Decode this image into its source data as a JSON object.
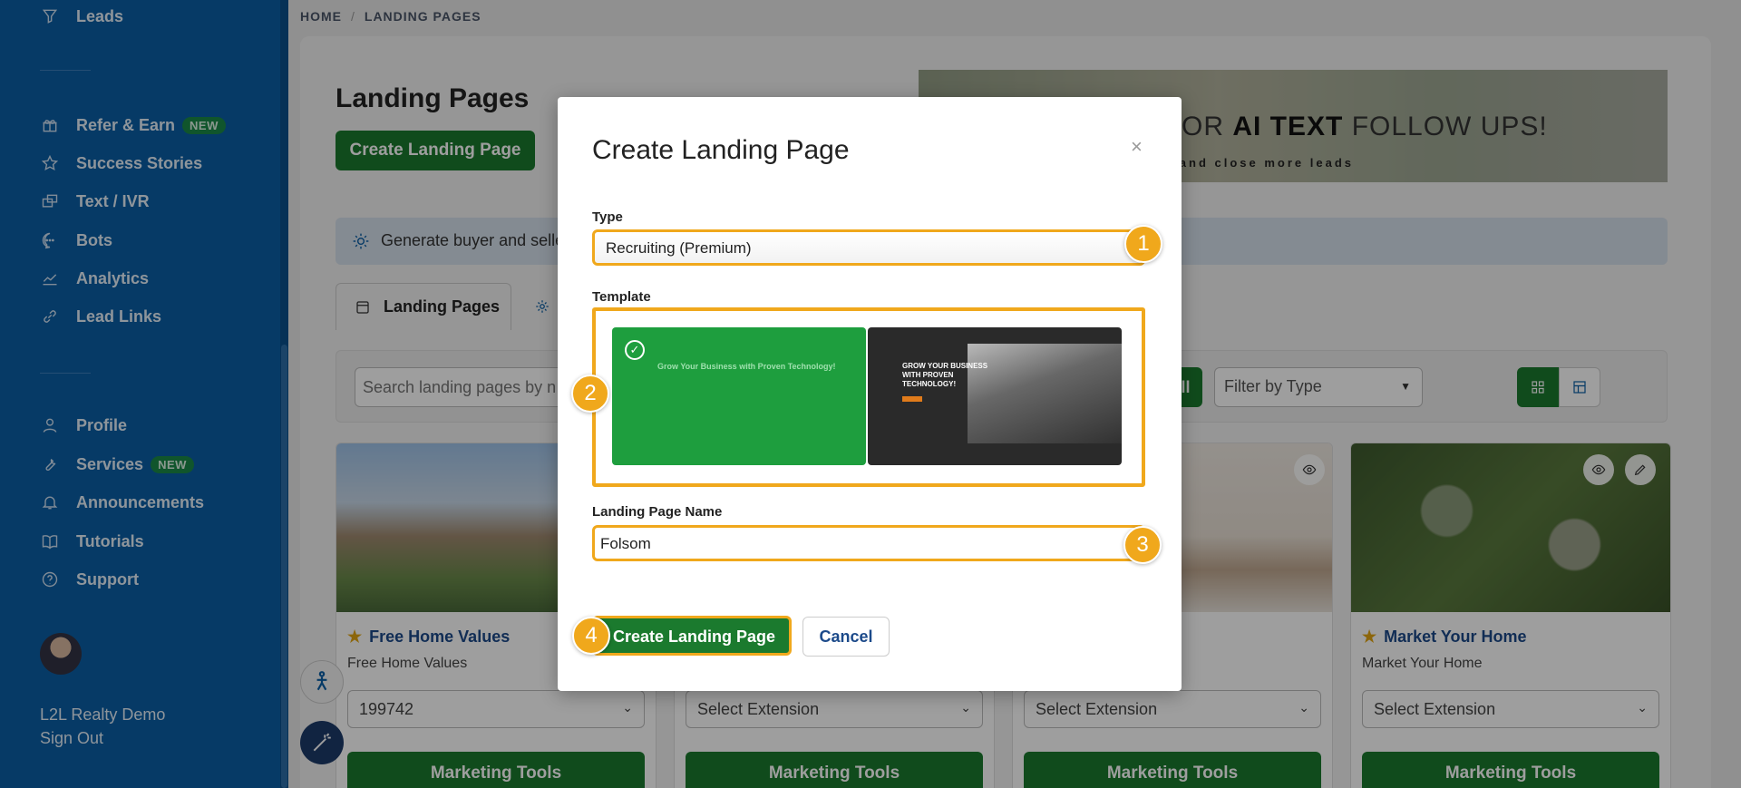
{
  "sidebar": {
    "items_top": [
      {
        "label": "Leads",
        "icon": "filter-icon"
      }
    ],
    "items_mid": [
      {
        "label": "Refer & Earn",
        "icon": "gift-icon",
        "badge": "NEW"
      },
      {
        "label": "Success Stories",
        "icon": "star-icon"
      },
      {
        "label": "Text / IVR",
        "icon": "chat-icon"
      },
      {
        "label": "Bots",
        "icon": "bot-icon"
      },
      {
        "label": "Analytics",
        "icon": "chart-icon"
      },
      {
        "label": "Lead Links",
        "icon": "link-icon"
      }
    ],
    "items_bottom": [
      {
        "label": "Profile",
        "icon": "user-icon"
      },
      {
        "label": "Services",
        "icon": "wrench-icon",
        "badge": "NEW"
      },
      {
        "label": "Announcements",
        "icon": "bell-icon"
      },
      {
        "label": "Tutorials",
        "icon": "book-icon"
      },
      {
        "label": "Support",
        "icon": "help-icon"
      }
    ],
    "user_name": "L2L Realty Demo",
    "sign_out": "Sign Out"
  },
  "breadcrumb": {
    "home": "HOME",
    "current": "LANDING PAGES"
  },
  "page": {
    "title": "Landing Pages",
    "create_button": "Create Landing Page",
    "banner_text_prefix": "OR ",
    "banner_text_bold": "AI TEXT",
    "banner_text_suffix": " FOLLOW UPS!",
    "banner_sub_prefix": "ge and close ",
    "banner_sub_bold": "more leads",
    "info_text": "Generate buyer and selle",
    "tab_active": "Landing Pages",
    "search_placeholder": "Search landing pages by nam",
    "all_button": "All",
    "filter_label": "Filter by Type"
  },
  "cards": [
    {
      "title": "Free Home Values",
      "subtitle": "Free Home Values",
      "select": "199742",
      "tools": "Marketing Tools"
    },
    {
      "title": "",
      "subtitle": "",
      "select": "Select Extension",
      "tools": "Marketing Tools"
    },
    {
      "title": "",
      "subtitle": "",
      "select": "Select Extension",
      "tools": "Marketing Tools"
    },
    {
      "title": "Market Your Home",
      "subtitle": "Market Your Home",
      "select": "Select Extension",
      "tools": "Marketing Tools"
    }
  ],
  "modal": {
    "title": "Create Landing Page",
    "close": "×",
    "type_label": "Type",
    "type_value": "Recruiting (Premium)",
    "template_label": "Template",
    "template_1_headline": "Grow Your Business with Proven Technology!",
    "template_2_headline": "GROW YOUR BUSINESS WITH PROVEN TECHNOLOGY!",
    "name_label": "Landing Page Name",
    "name_value": "Folsom",
    "create_button": "Create Landing Page",
    "cancel_button": "Cancel"
  },
  "markers": [
    "1",
    "2",
    "3",
    "4"
  ],
  "colors": {
    "sidebar": "#0b5ea5",
    "primary_green": "#1b7a2e",
    "highlight": "#f0a81c",
    "link_blue": "#1c4a8a"
  }
}
